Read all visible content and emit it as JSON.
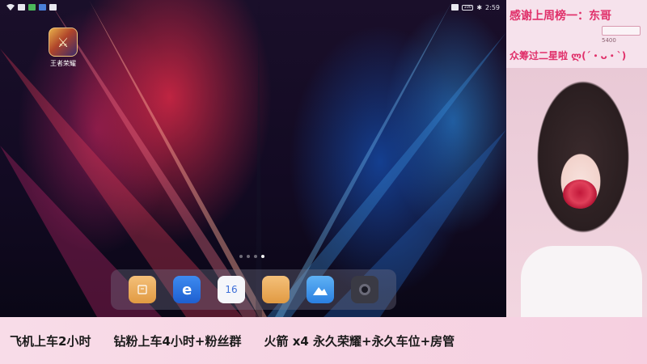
{
  "statusbar": {
    "time": "2:59",
    "battery": "100"
  },
  "desktop": {
    "app": {
      "label": "王者荣耀",
      "icon": "game-icon"
    }
  },
  "dock": {
    "apps": [
      {
        "name": "files",
        "icon": "files-icon",
        "glyph": "⌂"
      },
      {
        "name": "browser",
        "icon": "browser-icon",
        "glyph": "e"
      },
      {
        "name": "calendar",
        "icon": "calendar-icon",
        "glyph": "16"
      },
      {
        "name": "notes",
        "icon": "notes-icon",
        "glyph": ""
      },
      {
        "name": "gallery",
        "icon": "gallery-icon",
        "glyph": "▲"
      },
      {
        "name": "camera",
        "icon": "camera-icon",
        "glyph": ""
      }
    ]
  },
  "stream": {
    "thanks_text": "感谢上周榜一：",
    "thanks_name": "东哥",
    "tag_count": "5400",
    "crowd_text": "众筹过二星啦 ლ(´・ᴗ・`)"
  },
  "banner": {
    "items": [
      "飞机上车2小时",
      "钻粉上车4小时+粉丝群",
      "火箭 x4 永久荣耀+永久车位+房管"
    ]
  },
  "colors": {
    "accent_pink": "#e0306a",
    "banner_bg": "#f8dce8"
  }
}
